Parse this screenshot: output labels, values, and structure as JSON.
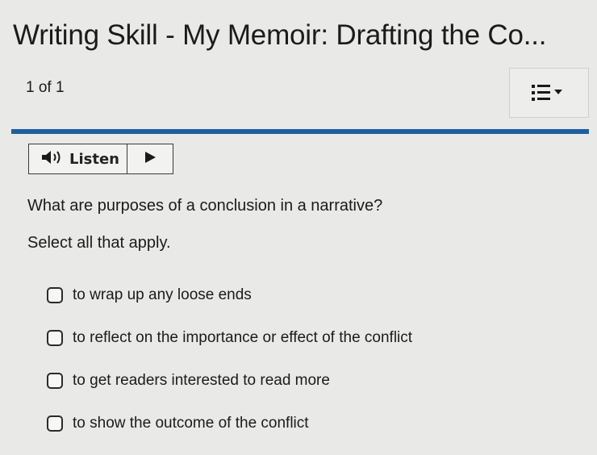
{
  "header": {
    "title": "Writing Skill - My Memoir: Drafting the Co...",
    "counter": "1 of 1"
  },
  "toolbar": {
    "menu_icon": "list-dropdown-icon",
    "accent_color": "#1f5f9e"
  },
  "listen": {
    "label": "Listen",
    "icon": "speaker-icon",
    "play_icon": "play-icon"
  },
  "question": {
    "prompt": "What are purposes of a conclusion in a narrative?",
    "instruction": "Select all that apply.",
    "options": [
      {
        "label": "to wrap up any loose ends",
        "checked": false
      },
      {
        "label": "to reflect on the importance or effect of the conflict",
        "checked": false
      },
      {
        "label": "to get readers interested to read more",
        "checked": false
      },
      {
        "label": "to show the outcome of the conflict",
        "checked": false
      }
    ]
  }
}
